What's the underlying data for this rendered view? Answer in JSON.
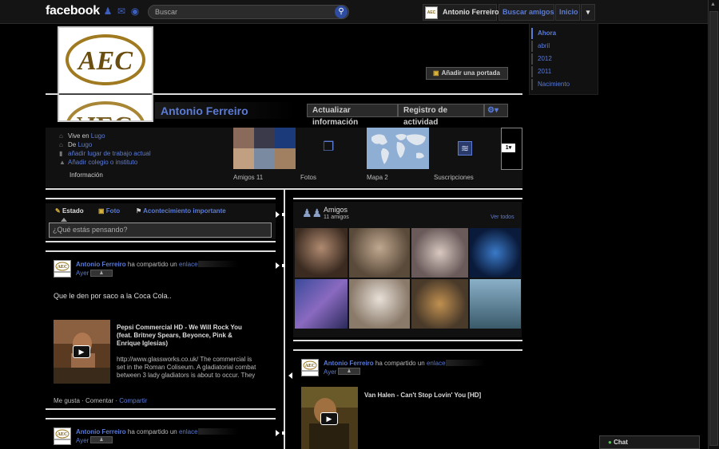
{
  "topbar": {
    "logo": "facebook",
    "search_placeholder": "Buscar",
    "user_name": "Antonio Ferreiro",
    "find_friends": "Buscar amigos",
    "home": "Inicio"
  },
  "cover": {
    "add_cover_label": "Añadir una portada",
    "profile_name": "Antonio Ferreiro",
    "update_info_label": "Actualizar información",
    "activity_log_label": "Registro de actividad",
    "monogram": "AEC"
  },
  "timeline_nav": [
    "Ahora",
    "abril",
    "2012",
    "2011",
    "Nacimiento"
  ],
  "info": {
    "lives_prefix": "Vive en",
    "lives_city": "Lugo",
    "from_prefix": "De",
    "from_city": "Lugo",
    "add_work": "añadir lugar de trabajo actual",
    "add_school": "Añadir colegio o instituto",
    "info_label": "Información"
  },
  "tiles": {
    "friends": "Amigos 11",
    "photos": "Fotos",
    "map": "Mapa 2",
    "subscriptions": "Suscripciones",
    "more_count": "1"
  },
  "composer": {
    "tab_status": "Estado",
    "tab_photo": "Foto",
    "tab_event": "Acontecimiento importante",
    "placeholder": "¿Qué estás pensando?"
  },
  "post1": {
    "author": "Antonio Ferreiro",
    "action": "ha compartido un",
    "link": "enlace",
    "time": "Ayer",
    "message": "Que le den por saco a la Coca Cola..",
    "video_title": "Pepsi Commercial HD - We Will Rock You (feat. Britney Spears, Beyonce, Pink & Enrique Iglesias)",
    "video_url": "http://www.glassworks.co.uk/",
    "video_desc": "The commercial is set in the Roman Coliseum. A gladiatorial combat between 3 lady gladiators is about to occur. They",
    "like": "Me gusta",
    "comment": "Comentar",
    "share": "Compartir"
  },
  "post2": {
    "author": "Antonio Ferreiro",
    "action": "ha compartido un",
    "link": "enlace",
    "time": "Ayer"
  },
  "post3": {
    "author": "Antonio Ferreiro",
    "action": "ha compartido un",
    "link": "enlace",
    "time": "Ayer",
    "video_title": "Van Halen - Can't Stop Lovin' You [HD]"
  },
  "friends_box": {
    "title": "Amigos",
    "count": "11 amigos",
    "see_all": "Ver todos"
  },
  "chat": {
    "label": "Chat"
  },
  "colors": {
    "link": "#5b7bd5",
    "background": "#000000",
    "divider": "#dddddd"
  }
}
